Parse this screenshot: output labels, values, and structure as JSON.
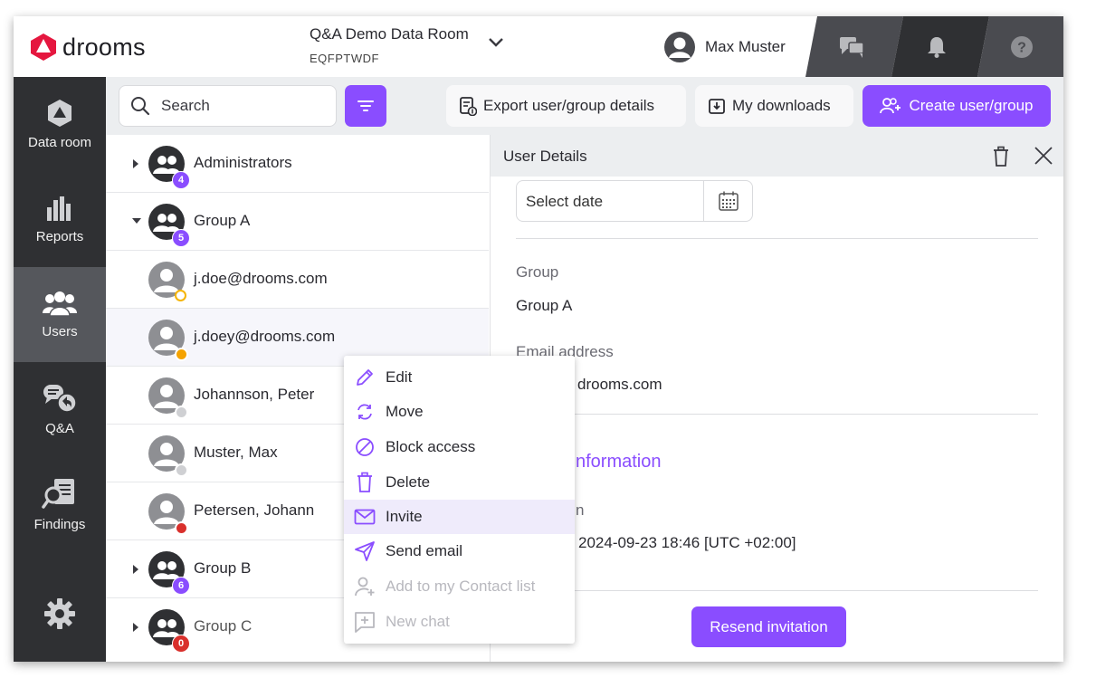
{
  "header": {
    "brand": "drooms",
    "room_name": "Q&A Demo Data Room",
    "room_code": "EQFPTWDF",
    "user_name": "Max Muster"
  },
  "sidebar": {
    "items": [
      {
        "label": "Data room",
        "icon": "data-room-icon"
      },
      {
        "label": "Reports",
        "icon": "bar-chart-icon"
      },
      {
        "label": "Users",
        "icon": "users-icon",
        "active": true
      },
      {
        "label": "Q&A",
        "icon": "qa-icon"
      },
      {
        "label": "Findings",
        "icon": "findings-icon"
      }
    ]
  },
  "toolbar": {
    "search_placeholder": "Search",
    "export_label": "Export user/group details",
    "downloads_label": "My downloads",
    "create_label": "Create user/group"
  },
  "tree": {
    "rows": [
      {
        "label": "Administrators",
        "type": "group",
        "count": "4",
        "expanded": false
      },
      {
        "label": "Group A",
        "type": "group",
        "count": "5",
        "expanded": true
      },
      {
        "label": "j.doe@drooms.com",
        "type": "user",
        "status_color": "#f5b400"
      },
      {
        "label": "j.doey@drooms.com",
        "type": "user",
        "status_color": "#f5a300"
      },
      {
        "label": "Johannson, Peter",
        "type": "user",
        "status_color": "#cfd0d3"
      },
      {
        "label": "Muster, Max",
        "type": "user",
        "status_color": "#cfd0d3"
      },
      {
        "label": "Petersen, Johann",
        "type": "user",
        "status_color": "#d9302c"
      },
      {
        "label": "Group B",
        "type": "group",
        "count": "6",
        "expanded": false
      },
      {
        "label": "Group C",
        "type": "group",
        "count": "0",
        "expanded": false
      }
    ]
  },
  "details": {
    "title": "User Details",
    "date_placeholder": "Select date",
    "group_label": "Group",
    "group_value": "Group A",
    "email_label": "Email address",
    "email_value_visible": "drooms.com",
    "info_title_visible": "nformation",
    "info_label_visible": "n",
    "info_value_visible": "2024-09-23 18:46 [UTC +02:00]",
    "resend_label": "Resend invitation"
  },
  "context_menu": {
    "items": [
      {
        "label": "Edit",
        "icon": "pencil-icon"
      },
      {
        "label": "Move",
        "icon": "move-icon"
      },
      {
        "label": "Block access",
        "icon": "block-icon"
      },
      {
        "label": "Delete",
        "icon": "trash-icon"
      },
      {
        "label": "Invite",
        "icon": "mail-icon",
        "selected": true
      },
      {
        "label": "Send email",
        "icon": "send-icon"
      },
      {
        "label": "Add to my Contact list",
        "icon": "add-contact-icon",
        "disabled": true
      },
      {
        "label": "New chat",
        "icon": "new-chat-icon",
        "disabled": true
      }
    ]
  },
  "colors": {
    "accent": "#8a4dff",
    "sidebar_bg": "#2f3033",
    "sidebar_active": "#55575c",
    "brand_red": "#e5173f"
  }
}
